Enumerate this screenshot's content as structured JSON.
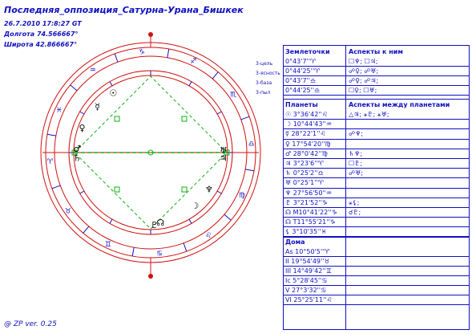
{
  "header": {
    "title": "Последняя_оппозиция_Сатурна-Урана_Бишкек",
    "datetime": "26.7.2010 17:8:27 GT",
    "longitude": "Долгота 74.566667°",
    "latitude": "Широта 42.866667°"
  },
  "side_labels": [
    "3-цель",
    "3-ясность",
    "3-база",
    "3-пыл"
  ],
  "footer": "@ ZP  ver. 0.25",
  "colors": {
    "text": "#1010c0",
    "ring": "#d01010",
    "houses": "#1010c0",
    "aspects": "#10b010",
    "axis": "#d01010"
  },
  "chart": {
    "zodiac_signs": [
      "aries",
      "taurus",
      "gemini",
      "cancer",
      "leo",
      "virgo",
      "libra",
      "scorpio",
      "sagittarius",
      "capricorn",
      "aquarius",
      "pisces"
    ],
    "sign_glyphs": [
      "♈",
      "♉",
      "♊",
      "♋",
      "♌",
      "♍",
      "♎",
      "♏",
      "♐",
      "♑",
      "♒",
      "♓"
    ],
    "planet_glyphs": [
      {
        "name": "sun",
        "glyph": "☉"
      },
      {
        "name": "mercury",
        "glyph": "☿"
      },
      {
        "name": "venus",
        "glyph": "♀"
      },
      {
        "name": "mars",
        "glyph": "♂"
      },
      {
        "name": "saturn",
        "glyph": "♄"
      },
      {
        "name": "uranus",
        "glyph": "♅"
      },
      {
        "name": "jupiter",
        "glyph": "♃"
      },
      {
        "name": "neptune",
        "glyph": "♆"
      },
      {
        "name": "moon",
        "glyph": "☽"
      },
      {
        "name": "pluto",
        "glyph": "♇"
      },
      {
        "name": "north-node",
        "glyph": "☊"
      }
    ]
  },
  "table": {
    "earthpoints_header": "Землеточки",
    "earthpoints_aspects_header": "Аспекты к ним",
    "earthpoints": [
      {
        "pos": "0°43'7''♈",
        "aspects": "☐♆; ☐♃;"
      },
      {
        "pos": "0°44'25''♈",
        "aspects": "☍♀; ☍♅;"
      },
      {
        "pos": "0°43'7''♎",
        "aspects": "☍♀; ☍♃;"
      },
      {
        "pos": "0°44'25''♎",
        "aspects": "☐♀; ☐♅;"
      }
    ],
    "planets_header": "Планеты",
    "planet_aspects_header": "Аспекты между планетами",
    "planets": [
      {
        "pos": "☉ 3°36'42''♌",
        "aspects": "△♃; ⚹♇; ⚹♅;"
      },
      {
        "pos": "☽ 10°44'43''♒",
        "aspects": ""
      },
      {
        "pos": "☿ 28°22'1''♌",
        "aspects": "☍♆;"
      },
      {
        "pos": "♀ 17°54'20''♍",
        "aspects": ""
      },
      {
        "pos": "♂ 28°0'42''♍",
        "aspects": "♄♆;"
      },
      {
        "pos": "♃ 3°23'6''♈",
        "aspects": "☐♇;"
      },
      {
        "pos": "♄ 0°25'2''♎",
        "aspects": "☍♅;"
      },
      {
        "pos": "♅ 0°25'1''♈",
        "aspects": ""
      },
      {
        "pos": "♆ 27°56'50''♒",
        "aspects": ""
      },
      {
        "pos": "♇ 3°21'52''♑",
        "aspects": "⚹⚸;"
      },
      {
        "pos": "☊ M10°41'22''♑",
        "aspects": "☌♇;"
      },
      {
        "pos": "☊ T11°55'21''♑",
        "aspects": ""
      },
      {
        "pos": "⚸ 3°10'35''♓",
        "aspects": ""
      }
    ],
    "houses_header": "Дома",
    "houses": [
      "As 10°50'5''♈",
      "II 19°54'49''♉",
      "III 14°49'42''♊",
      "Ic 5°28'45''♋",
      "V 27°3'32''♋",
      "VI 25°25'11''♌"
    ]
  }
}
